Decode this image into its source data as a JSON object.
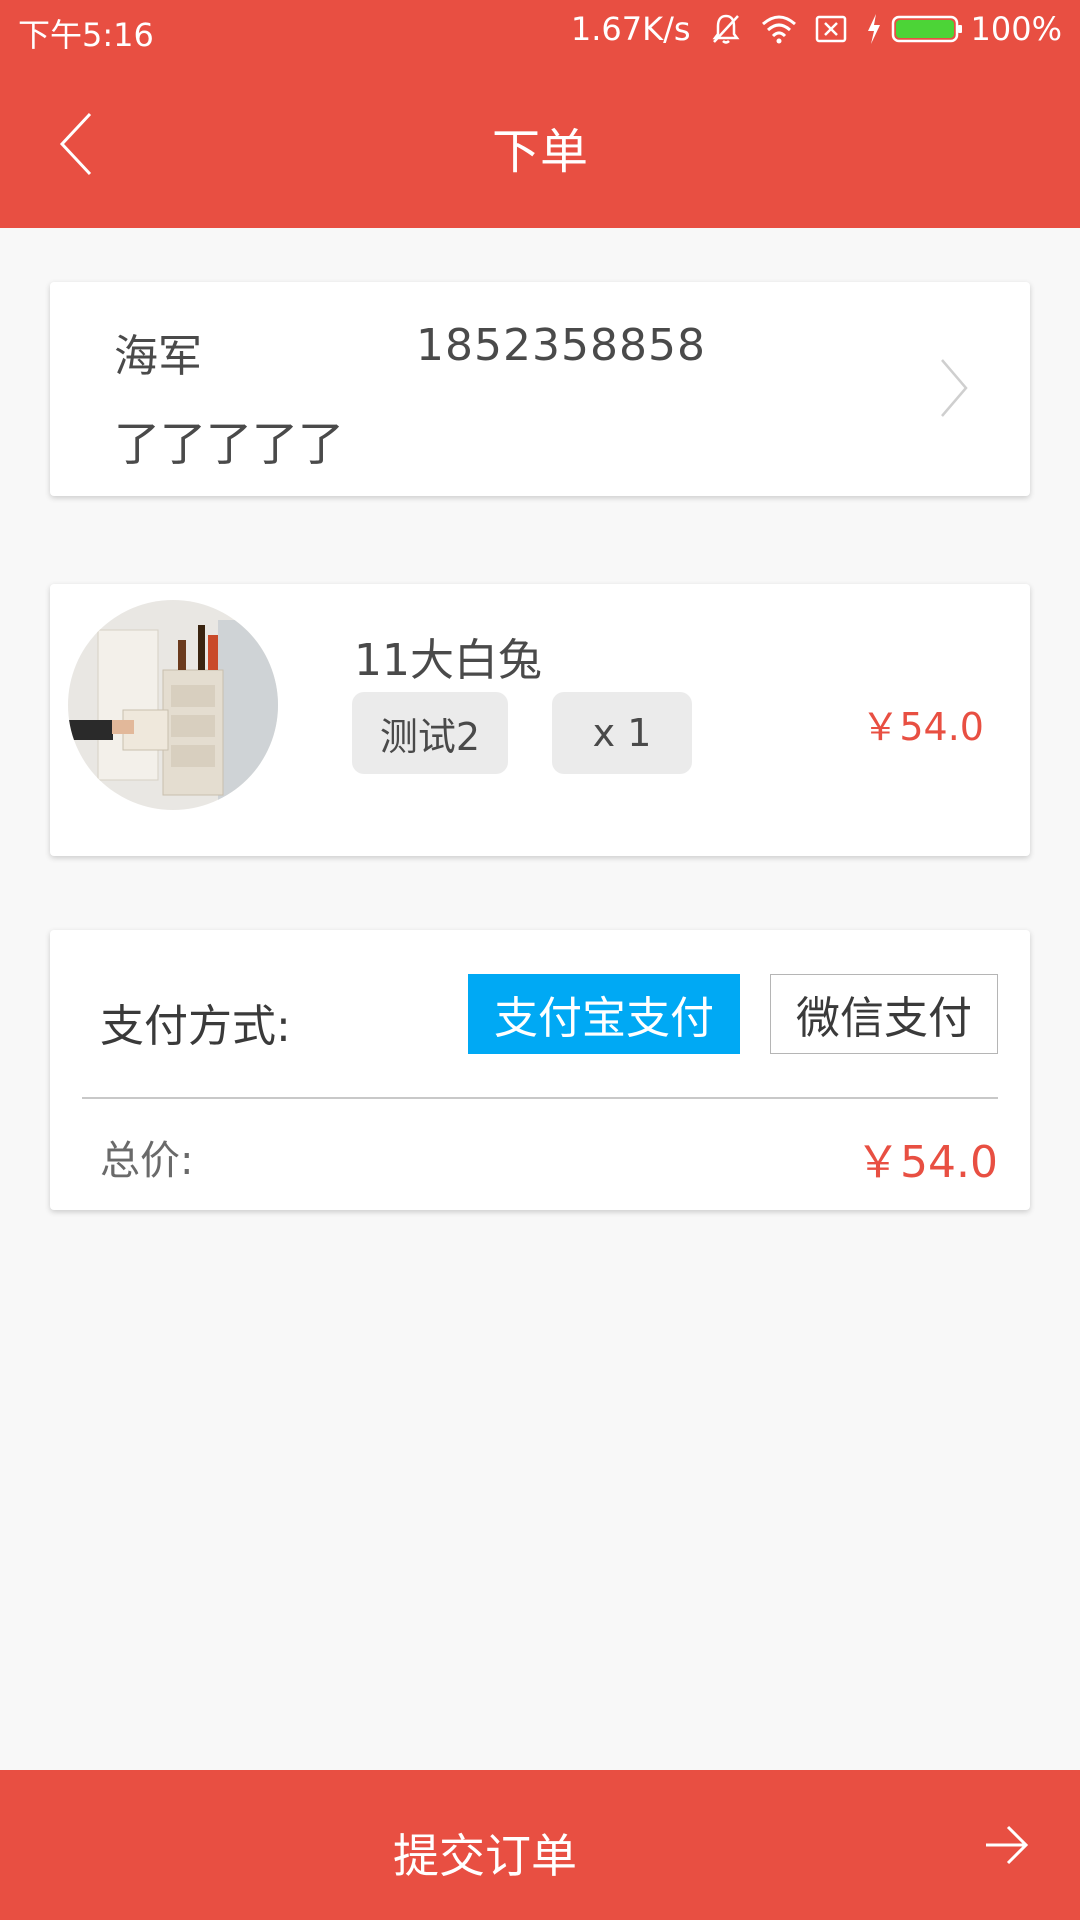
{
  "status_bar": {
    "time": "下午5:16",
    "speed": "1.67K/s",
    "battery": "100%"
  },
  "header": {
    "title": "下单"
  },
  "address": {
    "name": "海军",
    "phone": "1852358858",
    "detail": "了了了了了"
  },
  "item": {
    "name": "11大白兔",
    "spec": "测试2",
    "quantity": "x 1",
    "price": "￥54.0"
  },
  "payment": {
    "label": "支付方式:",
    "options": [
      "支付宝支付",
      "微信支付"
    ],
    "selected": "支付宝支付",
    "total_label": "总价:",
    "total_value": "￥54.0"
  },
  "submit": {
    "label": "提交订单"
  },
  "colors": {
    "brand": "#e84f42",
    "selected_pay": "#00a9f4"
  }
}
